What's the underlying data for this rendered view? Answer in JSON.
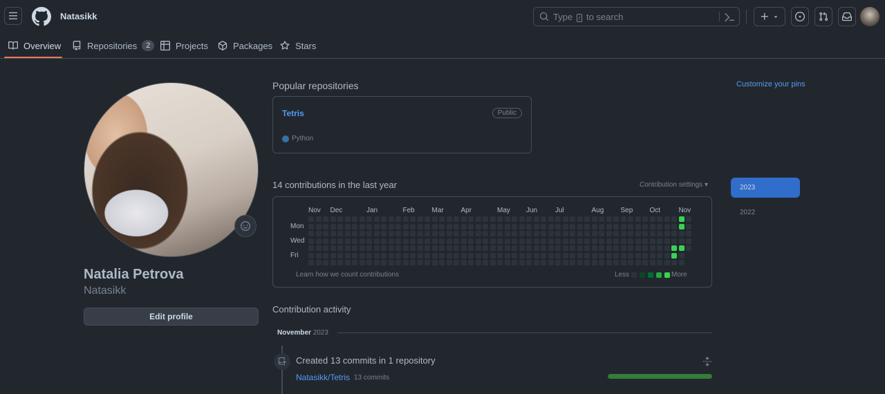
{
  "header": {
    "username": "Natasikk",
    "search_prefix": "Type",
    "search_key": "/",
    "search_suffix": "to search"
  },
  "tabs": [
    {
      "label": "Overview",
      "icon": "book-icon"
    },
    {
      "label": "Repositories",
      "icon": "repo-icon",
      "count": "2"
    },
    {
      "label": "Projects",
      "icon": "table-icon"
    },
    {
      "label": "Packages",
      "icon": "package-icon"
    },
    {
      "label": "Stars",
      "icon": "star-icon"
    }
  ],
  "profile": {
    "name": "Natalia Petrova",
    "login": "Natasikk",
    "edit_label": "Edit profile"
  },
  "popular": {
    "title": "Popular repositories",
    "customize": "Customize your pins",
    "repos": [
      {
        "name": "Tetris",
        "visibility": "Public",
        "language": "Python",
        "language_color": "#3572a5"
      }
    ]
  },
  "contributions": {
    "title": "14 contributions in the last year",
    "settings": "Contribution settings ▾",
    "months": [
      "Nov",
      "Dec",
      "Jan",
      "Feb",
      "Mar",
      "Apr",
      "May",
      "Jun",
      "Jul",
      "Aug",
      "Sep",
      "Oct",
      "Nov"
    ],
    "days": [
      "Mon",
      "Wed",
      "Fri"
    ],
    "learn": "Learn how we count contributions",
    "less": "Less",
    "more": "More",
    "level_colors": [
      "#2d333b",
      "#0e4429",
      "#006d32",
      "#26a641",
      "#39d353"
    ],
    "active_cells": [
      {
        "week": 50,
        "day": 4,
        "level": 4
      },
      {
        "week": 50,
        "day": 5,
        "level": 4
      },
      {
        "week": 51,
        "day": 0,
        "level": 4
      },
      {
        "week": 51,
        "day": 1,
        "level": 4
      },
      {
        "week": 51,
        "day": 4,
        "level": 4
      }
    ]
  },
  "years": [
    "2023",
    "2022"
  ],
  "activity": {
    "title": "Contribution activity",
    "month": "November",
    "year": "2023",
    "summary": "Created 13 commits in 1 repository",
    "repo": "Natasikk/Tetris",
    "commits": "13 commits",
    "progress": 1.0
  }
}
